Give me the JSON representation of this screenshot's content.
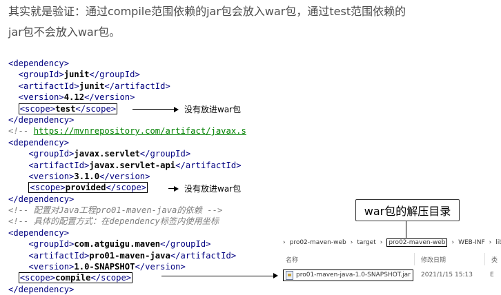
{
  "intro": {
    "line1": "其实就是验证：通过compile范围依赖的jar包会放入war包，通过test范围依赖的",
    "line2": "jar包不会放入war包。"
  },
  "code_lines": [
    [
      {
        "t": "tag",
        "v": "<dependency>"
      }
    ],
    [
      {
        "t": "tag",
        "v": "  <groupId>"
      },
      {
        "t": "val",
        "v": "junit"
      },
      {
        "t": "tag",
        "v": "</groupId>"
      }
    ],
    [
      {
        "t": "tag",
        "v": "  <artifactId>"
      },
      {
        "t": "val",
        "v": "junit"
      },
      {
        "t": "tag",
        "v": "</artifactId>"
      }
    ],
    [
      {
        "t": "tag",
        "v": "  <version>"
      },
      {
        "t": "val",
        "v": "4.12"
      },
      {
        "t": "tag",
        "v": "</version>"
      }
    ],
    [
      {
        "t": "pad",
        "v": "  "
      },
      {
        "t": "box",
        "parts": [
          {
            "t": "tag",
            "v": "<scope>"
          },
          {
            "t": "val",
            "v": "test"
          },
          {
            "t": "tag",
            "v": "</scope>"
          }
        ]
      }
    ],
    [
      {
        "t": "tag",
        "v": "</dependency>"
      }
    ],
    [
      {
        "t": "cmt",
        "v": "<!-- "
      },
      {
        "t": "url",
        "v": "https://mvnrepository.com/artifact/javax.s"
      }
    ],
    [
      {
        "t": "tag",
        "v": "<dependency>"
      }
    ],
    [
      {
        "t": "tag",
        "v": "    <groupId>"
      },
      {
        "t": "val",
        "v": "javax.servlet"
      },
      {
        "t": "tag",
        "v": "</groupId>"
      }
    ],
    [
      {
        "t": "tag",
        "v": "    <artifactId>"
      },
      {
        "t": "val",
        "v": "javax.servlet-api"
      },
      {
        "t": "tag",
        "v": "</artifactId>"
      }
    ],
    [
      {
        "t": "tag",
        "v": "    <version>"
      },
      {
        "t": "val",
        "v": "3.1.0"
      },
      {
        "t": "tag",
        "v": "</version>"
      }
    ],
    [
      {
        "t": "pad",
        "v": "    "
      },
      {
        "t": "box",
        "parts": [
          {
            "t": "tag",
            "v": "<scope>"
          },
          {
            "t": "val",
            "v": "provided"
          },
          {
            "t": "tag",
            "v": "</scope>"
          }
        ]
      }
    ],
    [
      {
        "t": "tag",
        "v": "</dependency>"
      }
    ],
    [
      {
        "t": "cmt",
        "v": "<!-- 配置对Java工程pro01-maven-java的依赖 -->"
      }
    ],
    [
      {
        "t": "cmt",
        "v": "<!-- 具体的配置方式：在dependency标签内使用坐标"
      }
    ],
    [
      {
        "t": "tag",
        "v": "<dependency>"
      }
    ],
    [
      {
        "t": "tag",
        "v": "    <groupId>"
      },
      {
        "t": "val",
        "v": "com.atguigu.maven"
      },
      {
        "t": "tag",
        "v": "</groupId>"
      }
    ],
    [
      {
        "t": "tag",
        "v": "    <artifactId>"
      },
      {
        "t": "val",
        "v": "pro01-maven-java"
      },
      {
        "t": "tag",
        "v": "</artifactId>"
      }
    ],
    [
      {
        "t": "tag",
        "v": "    <version>"
      },
      {
        "t": "val",
        "v": "1.0-SNAPSHOT"
      },
      {
        "t": "tag",
        "v": "</version>"
      }
    ],
    [
      {
        "t": "pad",
        "v": "  "
      },
      {
        "t": "box",
        "parts": [
          {
            "t": "tag",
            "v": "<scope>"
          },
          {
            "t": "val",
            "v": "compile"
          },
          {
            "t": "tag",
            "v": "</scope>"
          }
        ]
      }
    ],
    [
      {
        "t": "tag",
        "v": "</dependency>"
      }
    ]
  ],
  "annotations": {
    "test_label": "没有放进war包",
    "provided_label": "没有放进war包",
    "callout": "war包的解压目录"
  },
  "explorer": {
    "path": [
      "pro02-maven-web",
      "target",
      "pro02-maven-web",
      "WEB-INF",
      "lib"
    ],
    "col_name": "名称",
    "col_date": "修改日期",
    "col_type": "类",
    "file_name": "pro01-maven-java-1.0-SNAPSHOT.jar",
    "file_date": "2021/1/15 15:13",
    "file_tail": "E"
  },
  "colors": {
    "tag": "#000080",
    "value": "#000000",
    "comment": "#808080",
    "url": "#008000"
  }
}
